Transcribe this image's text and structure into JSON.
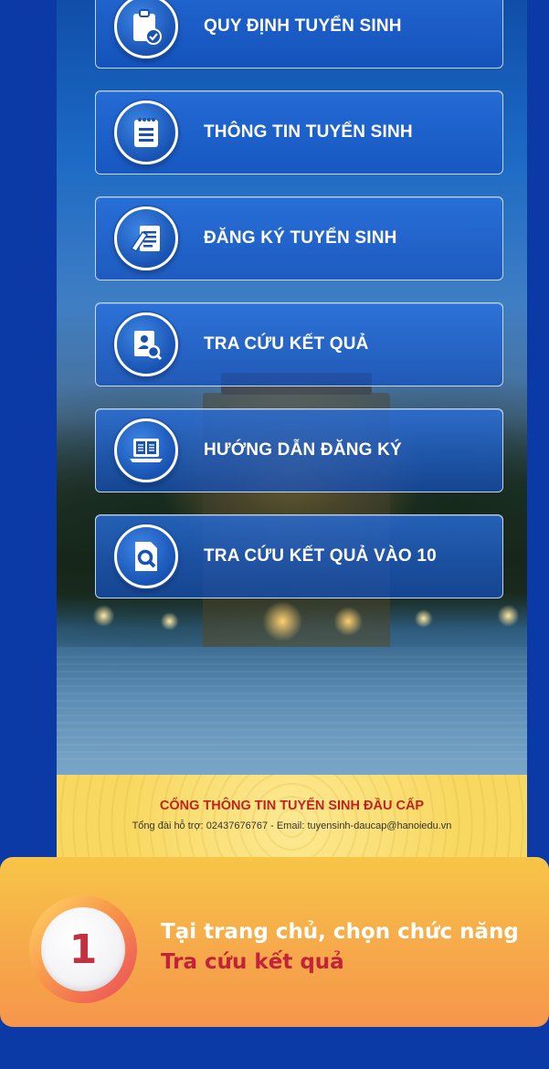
{
  "menu": {
    "items": [
      {
        "label": "QUY ĐỊNH TUYỂN SINH",
        "icon": "clipboard-check-icon"
      },
      {
        "label": "THÔNG TIN TUYỂN SINH",
        "icon": "notepad-icon"
      },
      {
        "label": "ĐĂNG KÝ TUYỂN SINH",
        "icon": "form-edit-icon"
      },
      {
        "label": "TRA CỨU KẾT QUẢ",
        "icon": "profile-search-icon"
      },
      {
        "label": "HƯỚNG DẪN ĐĂNG KÝ",
        "icon": "laptop-guide-icon"
      },
      {
        "label": "TRA CỨU KẾT QUẢ VÀO 10",
        "icon": "document-search-icon"
      }
    ]
  },
  "footer": {
    "title": "CỔNG THÔNG TIN TUYỂN SINH ĐẦU CẤP",
    "contact": "Tổng đài hỗ trợ: 02437676767 -  Email: tuyensinh-daucap@hanoiedu.vn"
  },
  "step": {
    "number": "1",
    "text_prefix": "Tại trang chủ, chọn chức năng ",
    "text_highlight": "Tra cứu kết quả"
  },
  "colors": {
    "page_background": "#0b3aa6",
    "menu_button": "#1f5fc9",
    "footer_title": "#c0231f",
    "step_card": "#f6a94a",
    "step_highlight": "#c0233a"
  }
}
